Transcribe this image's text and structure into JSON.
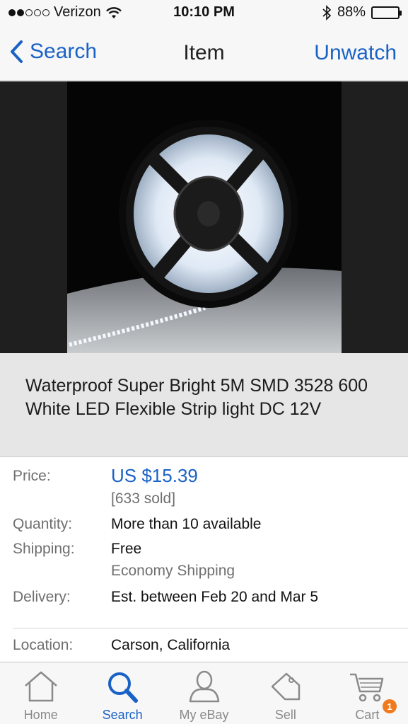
{
  "status_bar": {
    "carrier": "Verizon",
    "time": "10:10 PM",
    "battery": "88%",
    "battery_level": 0.88
  },
  "nav": {
    "back_label": "Search",
    "title": "Item",
    "action_label": "Unwatch"
  },
  "item": {
    "title": "Waterproof Super Bright 5M SMD 3528 600 White LED Flexible Strip light DC 12V"
  },
  "details": {
    "price_label": "Price:",
    "price_value": "US $15.39",
    "sold_text": "[633 sold]",
    "quantity_label": "Quantity:",
    "quantity_value": "More than 10 available",
    "shipping_label": "Shipping:",
    "shipping_value": "Free",
    "shipping_method": "Economy Shipping",
    "delivery_label": "Delivery:",
    "delivery_value": "Est. between Feb 20 and Mar 5",
    "location_label": "Location:",
    "location_value": "Carson, California"
  },
  "tabs": [
    {
      "label": "Home",
      "icon": "home-icon",
      "active": false
    },
    {
      "label": "Search",
      "icon": "search-icon",
      "active": true
    },
    {
      "label": "My eBay",
      "icon": "person-icon",
      "active": false
    },
    {
      "label": "Sell",
      "icon": "tag-icon",
      "active": false
    },
    {
      "label": "Cart",
      "icon": "cart-icon",
      "active": false
    }
  ],
  "cart_badge": "1",
  "colors": {
    "accent": "#1a62c6",
    "badge": "#f07a1e"
  }
}
